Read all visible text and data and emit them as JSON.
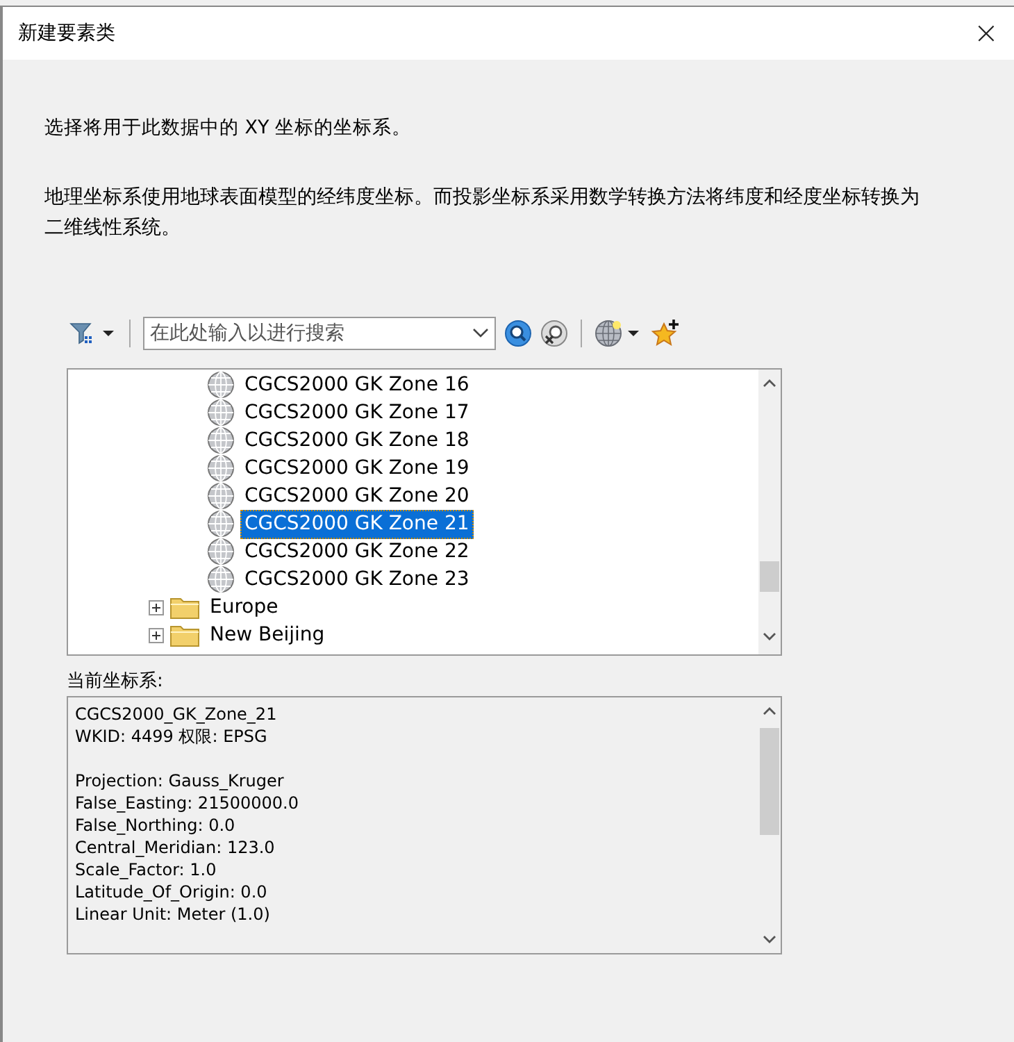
{
  "window": {
    "title": "新建要素类",
    "close": "×"
  },
  "intro": "选择将用于此数据中的 XY 坐标的坐标系。",
  "description": "地理坐标系使用地球表面模型的经纬度坐标。而投影坐标系采用数学转换方法将纬度和经度坐标转换为二维线性系统。",
  "search": {
    "placeholder": "在此处输入以进行搜索"
  },
  "tree": {
    "rows": [
      {
        "kind": "coordinate_system",
        "label": "CGCS2000 GK Zone 16",
        "selected": false
      },
      {
        "kind": "coordinate_system",
        "label": "CGCS2000 GK Zone 17",
        "selected": false
      },
      {
        "kind": "coordinate_system",
        "label": "CGCS2000 GK Zone 18",
        "selected": false
      },
      {
        "kind": "coordinate_system",
        "label": "CGCS2000 GK Zone 19",
        "selected": false
      },
      {
        "kind": "coordinate_system",
        "label": "CGCS2000 GK Zone 20",
        "selected": false
      },
      {
        "kind": "coordinate_system",
        "label": "CGCS2000 GK Zone 21",
        "selected": true
      },
      {
        "kind": "coordinate_system",
        "label": "CGCS2000 GK Zone 22",
        "selected": false
      },
      {
        "kind": "coordinate_system",
        "label": "CGCS2000 GK Zone 23",
        "selected": false
      },
      {
        "kind": "folder",
        "label": "Europe",
        "expanded": false
      },
      {
        "kind": "folder",
        "label": "New Beijing",
        "expanded": false
      }
    ]
  },
  "current": {
    "label": "当前坐标系:",
    "header": [
      "CGCS2000_GK_Zone_21",
      "WKID: 4499 权限: EPSG"
    ],
    "parameters": [
      "Projection: Gauss_Kruger",
      "False_Easting: 21500000.0",
      "False_Northing: 0.0",
      "Central_Meridian: 123.0",
      "Scale_Factor: 1.0",
      "Latitude_Of_Origin: 0.0",
      "Linear Unit: Meter (1.0)"
    ]
  }
}
